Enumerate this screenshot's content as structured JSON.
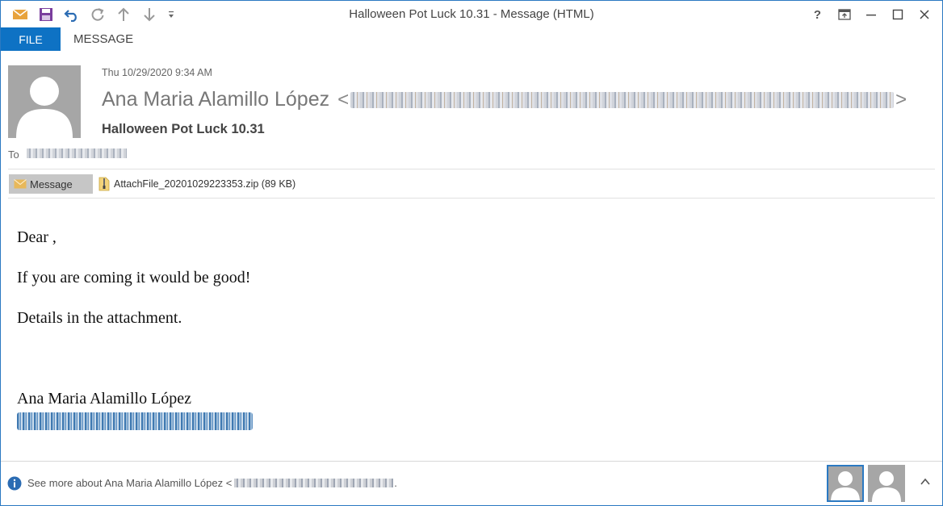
{
  "window": {
    "title": "Halloween Pot Luck 10.31 - Message (HTML)",
    "help_label": "?",
    "colors": {
      "accent": "#0e72c4",
      "border": "#2b79c2",
      "avatar": "#a6a6a6"
    }
  },
  "quick_access": {
    "icons": [
      "mail-icon",
      "save-icon",
      "undo-icon",
      "redo-icon",
      "up-arrow-icon",
      "down-arrow-icon",
      "customize-dropdown-icon"
    ]
  },
  "ribbon": {
    "file_tab": "FILE",
    "message_tab": "MESSAGE"
  },
  "header": {
    "date": "Thu 10/29/2020 9:34 AM",
    "sender_name": "Ana Maria Alamillo López",
    "sender_open": "<",
    "sender_close": ">",
    "subject": "Halloween Pot Luck 10.31",
    "to_label": "To"
  },
  "attachments": {
    "message_label": "Message",
    "file_name": "AttachFile_20201029223353.zip (89 KB)"
  },
  "body": {
    "greeting": "Dear ,",
    "line1": "If you are coming it would be good!",
    "line2": "Details in the attachment.",
    "signature_name": "Ana Maria Alamillo López"
  },
  "footer": {
    "see_more": "See more about Ana Maria Alamillo López <",
    "dot": "."
  }
}
